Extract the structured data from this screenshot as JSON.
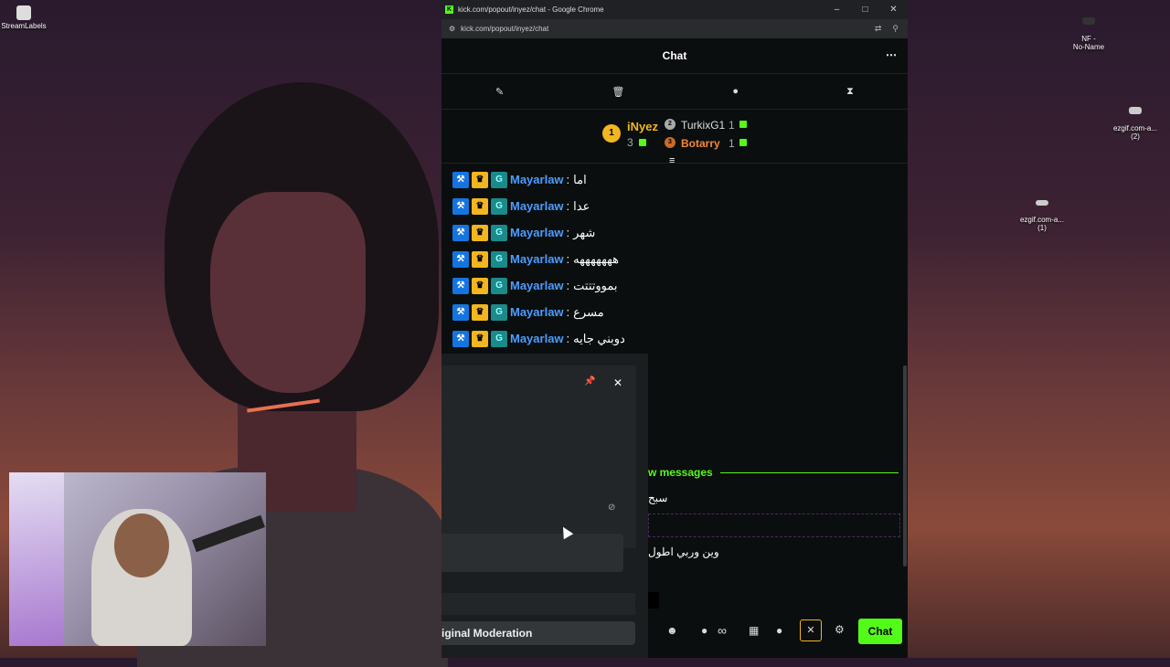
{
  "desktop": {
    "icons": [
      {
        "label": "StreamLabels"
      },
      {
        "label": "NF -\nNo-Name"
      },
      {
        "label": "ezgif.com-a...\n(2)"
      },
      {
        "label": "ezgif.com-a...\n(1)"
      }
    ]
  },
  "browser": {
    "title": "kick.com/popout/inyez/chat - Google Chrome",
    "url": "kick.com/popout/inyez/chat",
    "favicon": "K",
    "controls": {
      "minimize": "–",
      "maximize": "□",
      "close": "✕"
    }
  },
  "chat": {
    "header": "Chat",
    "menu_icon": "⋯",
    "toolbar": [
      "pin-icon",
      "trash-icon",
      "chat-bubble-icon",
      "hourglass-icon"
    ],
    "leaderboard": {
      "first": {
        "rank": "1",
        "name": "iNyez",
        "count": "3"
      },
      "second": {
        "rank": "2",
        "name": "TurkixG1",
        "count": "1"
      },
      "third": {
        "rank": "3",
        "name": "Botarry",
        "count": "1"
      }
    },
    "messages": [
      {
        "user": "Mayarlaw",
        "sep": ":",
        "text": "اما"
      },
      {
        "user": "Mayarlaw",
        "sep": ":",
        "text": "عدا"
      },
      {
        "user": "Mayarlaw",
        "sep": ":",
        "text": "شهر"
      },
      {
        "user": "Mayarlaw",
        "sep": ":",
        "text": "هههههههه"
      },
      {
        "user": "Mayarlaw",
        "sep": ":",
        "text": "بمووتتتت"
      },
      {
        "user": "Mayarlaw",
        "sep": ":",
        "text": "مسرع"
      },
      {
        "user": "Mayarlaw",
        "sep": ":",
        "text": "دوبني جايه"
      }
    ],
    "new_messages_label": "w messages",
    "partial_msg_1": "سبح",
    "partial_msg_2": "وين وربي اطول",
    "panel": {
      "moderation_label": "iginal Moderation",
      "pin_icon": "📌",
      "close_icon": "✕"
    },
    "chat_button": "Chat",
    "infinity": "∞"
  },
  "colors": {
    "kick_green": "#53fc18",
    "user_blue": "#4c9dff",
    "gold": "#f3b61f"
  }
}
